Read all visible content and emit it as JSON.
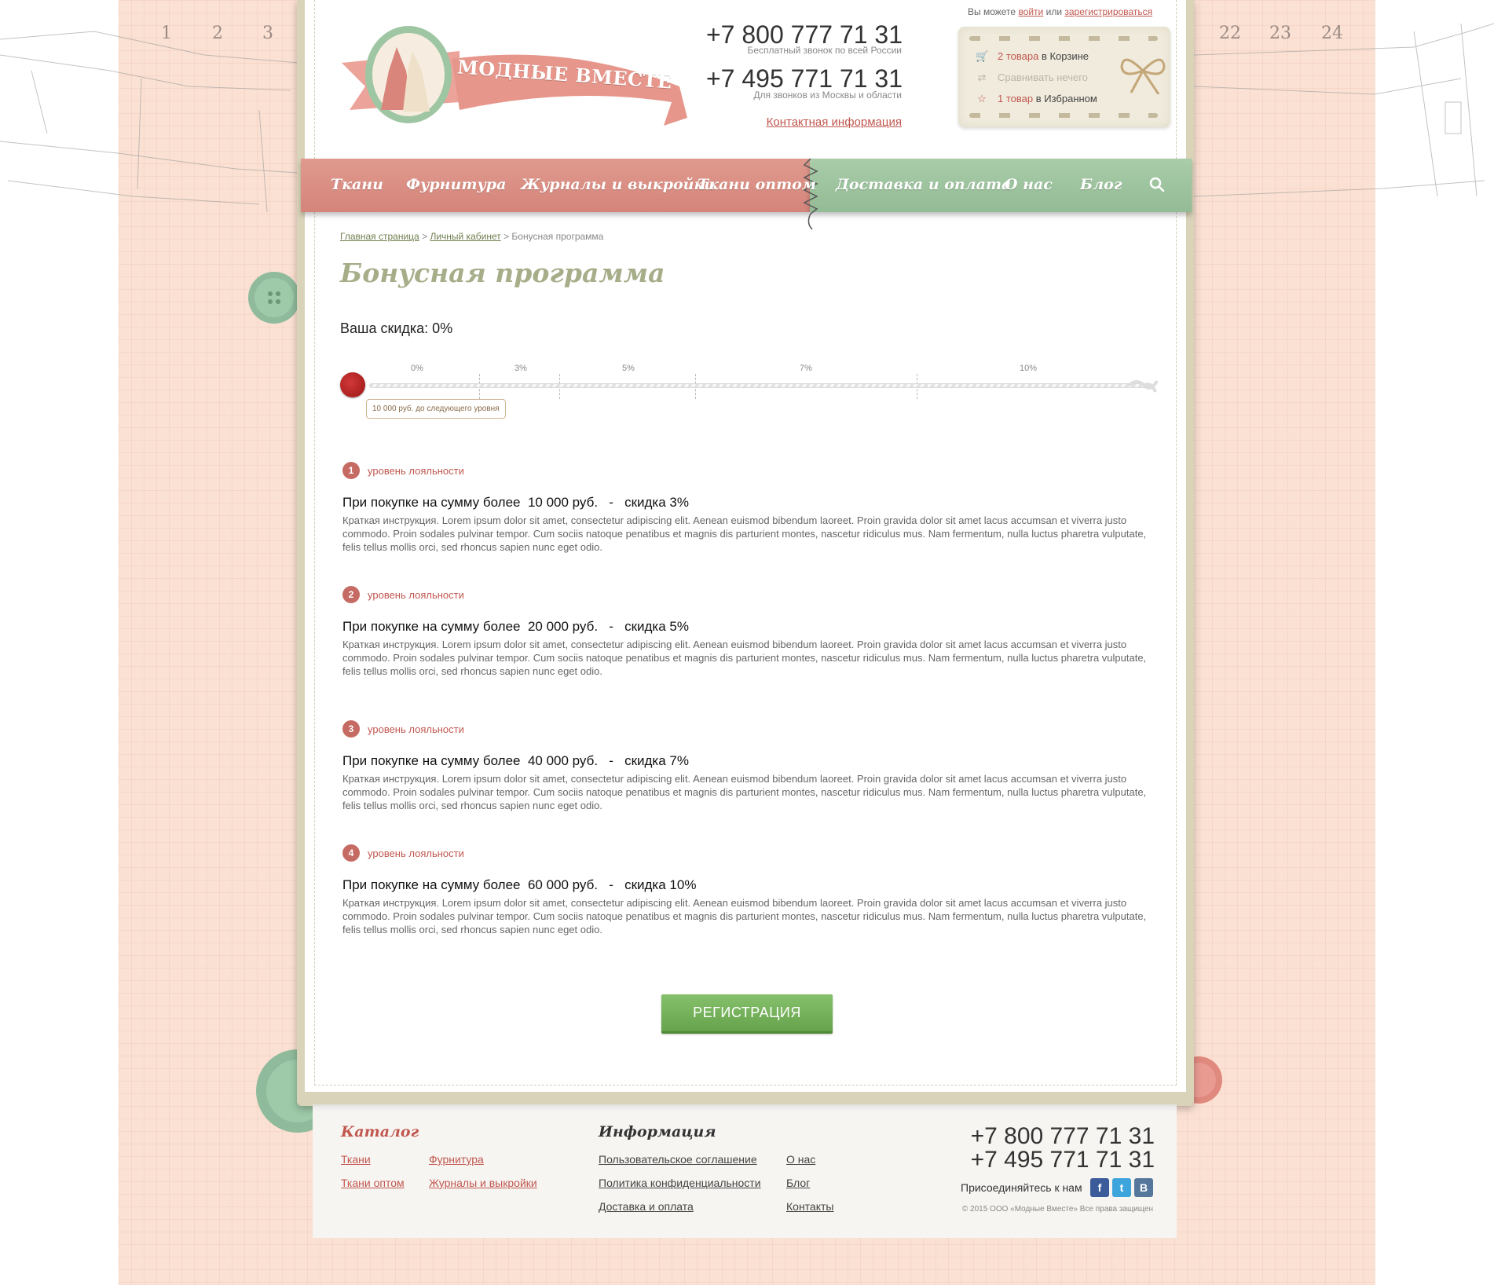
{
  "ruler": {
    "left_numbers": [
      "1",
      "2",
      "3"
    ],
    "right_numbers": [
      "22",
      "23",
      "24"
    ]
  },
  "logo": {
    "text": "МОДНЫЕ ВМЕСТЕ"
  },
  "header": {
    "phone1": "+7 800 777 71 31",
    "phone1_note": "Бесплатный звонок по всей России",
    "phone2": "+7 495 771 71 31",
    "phone2_note": "Для звонков из Москвы и области",
    "contact_link": "Контактная информация"
  },
  "auth": {
    "prefix": "Вы можете",
    "login": "войти",
    "or": "или",
    "register": "зарегистрироваться"
  },
  "user_box": {
    "cart_count": "2 товара",
    "cart_suffix": "в Корзине",
    "compare": "Сравнивать нечего",
    "fav_count": "1 товар",
    "fav_suffix": "в Избранном"
  },
  "nav": {
    "left": [
      "Ткани",
      "Фурнитура",
      "Журналы и выкройки",
      "Ткани оптом"
    ],
    "right": [
      "Доставка и оплата",
      "О нас",
      "Блог"
    ]
  },
  "breadcrumb": {
    "home": "Главная страница",
    "sep": ">",
    "cabinet": "Личный кабинет",
    "current": "Бонусная программа"
  },
  "page_title": "Бонусная программа",
  "discount_text": "Ваша скидка: 0%",
  "progress": {
    "ticks": [
      "0%",
      "3%",
      "5%",
      "7%",
      "10%"
    ],
    "current_value_percent": 0,
    "tooltip": "10 000 руб. до следующего уровня"
  },
  "levels": [
    {
      "num": "1",
      "label": "уровень лояльности",
      "title": "При покупке на сумму более  10 000 руб.   -   скидка 3%",
      "desc": "Краткая инструкция. Lorem ipsum dolor sit amet, consectetur adipiscing elit. Aenean euismod bibendum laoreet. Proin gravida dolor sit amet lacus accumsan et viverra justo commodo. Proin sodales pulvinar tempor. Cum sociis natoque penatibus et magnis dis parturient montes, nascetur ridiculus mus. Nam fermentum, nulla luctus pharetra vulputate, felis tellus mollis orci, sed rhoncus sapien nunc eget odio."
    },
    {
      "num": "2",
      "label": "уровень лояльности",
      "title": "При покупке на сумму более  20 000 руб.   -   скидка 5%",
      "desc": "Краткая инструкция. Lorem ipsum dolor sit amet, consectetur adipiscing elit. Aenean euismod bibendum laoreet. Proin gravida dolor sit amet lacus accumsan et viverra justo commodo. Proin sodales pulvinar tempor. Cum sociis natoque penatibus et magnis dis parturient montes, nascetur ridiculus mus. Nam fermentum, nulla luctus pharetra vulputate, felis tellus mollis orci, sed rhoncus sapien nunc eget odio."
    },
    {
      "num": "3",
      "label": "уровень лояльности",
      "title": "При покупке на сумму более  40 000 руб.   -   скидка 7%",
      "desc": "Краткая инструкция. Lorem ipsum dolor sit amet, consectetur adipiscing elit. Aenean euismod bibendum laoreet. Proin gravida dolor sit amet lacus accumsan et viverra justo commodo. Proin sodales pulvinar tempor. Cum sociis natoque penatibus et magnis dis parturient montes, nascetur ridiculus mus. Nam fermentum, nulla luctus pharetra vulputate, felis tellus mollis orci, sed rhoncus sapien nunc eget odio."
    },
    {
      "num": "4",
      "label": "уровень лояльности",
      "title": "При покупке на сумму более  60 000 руб.   -   скидка 10%",
      "desc": "Краткая инструкция. Lorem ipsum dolor sit amet, consectetur adipiscing elit. Aenean euismod bibendum laoreet. Proin gravida dolor sit amet lacus accumsan et viverra justo commodo. Proin sodales pulvinar tempor. Cum sociis natoque penatibus et magnis dis parturient montes, nascetur ridiculus mus. Nam fermentum, nulla luctus pharetra vulputate, felis tellus mollis orci, sed rhoncus sapien nunc eget odio."
    }
  ],
  "register_button": "РЕГИСТРАЦИЯ",
  "footer": {
    "catalog_title": "Каталог",
    "catalog_links": [
      "Ткани",
      "Фурнитура",
      "Ткани оптом",
      "Журналы и выкройки"
    ],
    "info_title": "Информация",
    "info_links": [
      "Пользовательское соглашение",
      "О нас",
      "Политика конфиденциальности",
      "Блог",
      "Доставка и оплата",
      "Контакты"
    ],
    "phone1": "+7 800 777 71 31",
    "phone2": "+7 495 771 71 31",
    "join": "Присоединяйтесь к нам",
    "social": [
      "f",
      "t",
      "B"
    ],
    "copyright": "© 2015 ООО «Модные Вместе» Все права защищен"
  },
  "colors": {
    "accent_red": "#c1574f",
    "nav_pink": "#d5847a",
    "nav_green": "#93bb95",
    "button_green": "#66a34c",
    "title_olive": "#a6ad89",
    "background_peach": "#fbe1d3"
  }
}
